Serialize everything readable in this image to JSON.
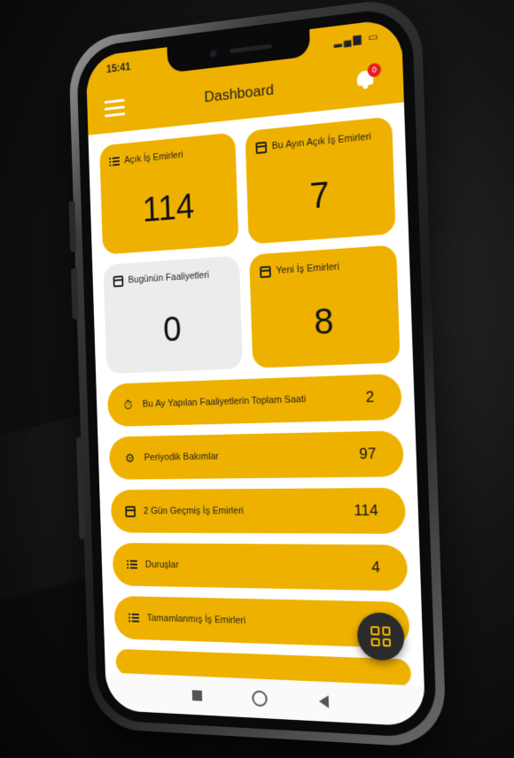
{
  "status_bar": {
    "time": "15:41"
  },
  "app_bar": {
    "title": "Dashboard",
    "notification_count": "0"
  },
  "cards": [
    {
      "label": "Açık İş Emirleri",
      "value": "114",
      "icon": "checklist-icon",
      "style": "accent"
    },
    {
      "label": "Bu Ayın Açık İş Emirleri",
      "value": "7",
      "icon": "calendar-icon",
      "style": "accent"
    },
    {
      "label": "Bugünün Faaliyetleri",
      "value": "0",
      "icon": "calendar-icon",
      "style": "grey"
    },
    {
      "label": "Yeni İş Emirleri",
      "value": "8",
      "icon": "calendar-icon",
      "style": "accent"
    }
  ],
  "rows": [
    {
      "label": "Bu Ay Yapılan Faaliyetlerin Toplam Saati",
      "value": "2",
      "icon": "stopwatch-icon"
    },
    {
      "label": "Periyodik Bakımlar",
      "value": "97",
      "icon": "gear-icon"
    },
    {
      "label": "2 Gün Geçmiş İş Emirleri",
      "value": "114",
      "icon": "calendar-icon"
    },
    {
      "label": "Duruşlar",
      "value": "4",
      "icon": "checklist-icon"
    },
    {
      "label": "Tamamlanmış İş Emirleri",
      "value": "",
      "icon": "checklist-icon"
    }
  ],
  "colors": {
    "accent": "#efb100",
    "grey_card": "#ececec",
    "fab": "#2b2b2b",
    "badge": "#e32020"
  },
  "fab": {
    "icon": "qr-code-icon"
  }
}
